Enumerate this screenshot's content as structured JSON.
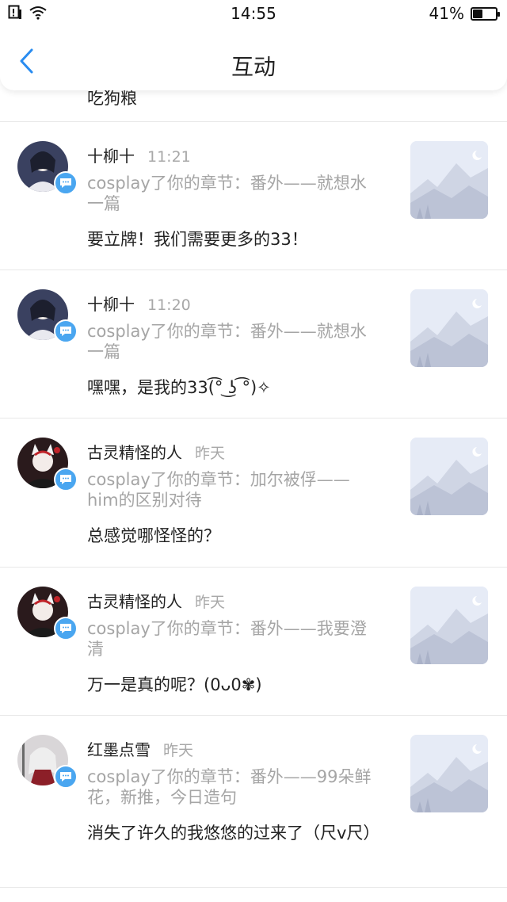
{
  "status_bar": {
    "time": "14:55",
    "battery_text": "41%",
    "battery_level": 0.41
  },
  "header": {
    "title": "互动"
  },
  "clipped_text": "吃狗粮",
  "items": [
    {
      "name": "十柳十",
      "time": "11:21",
      "subtitle": "cosplay了你的章节：番外——就想水一篇",
      "comment": "要立牌！我们需要更多的33！"
    },
    {
      "name": "十柳十",
      "time": "11:20",
      "subtitle": "cosplay了你的章节：番外——就想水一篇",
      "comment": "嘿嘿，是我的33(͡° ͜ʖ ͡°)✧"
    },
    {
      "name": "古灵精怪的人",
      "time": "昨天",
      "subtitle": "cosplay了你的章节：加尔被俘——him的区别对待",
      "comment": "总感觉哪怪怪的？"
    },
    {
      "name": "古灵精怪的人",
      "time": "昨天",
      "subtitle": "cosplay了你的章节：番外——我要澄清",
      "comment": "万一是真的呢？(0ᴗ0✾)"
    },
    {
      "name": "红墨点雪",
      "time": "昨天",
      "subtitle": "cosplay了你的章节：番外——99朵鲜花，新推，今日造句",
      "comment": "消失了许久的我悠悠的过来了（尺v尺）"
    }
  ]
}
